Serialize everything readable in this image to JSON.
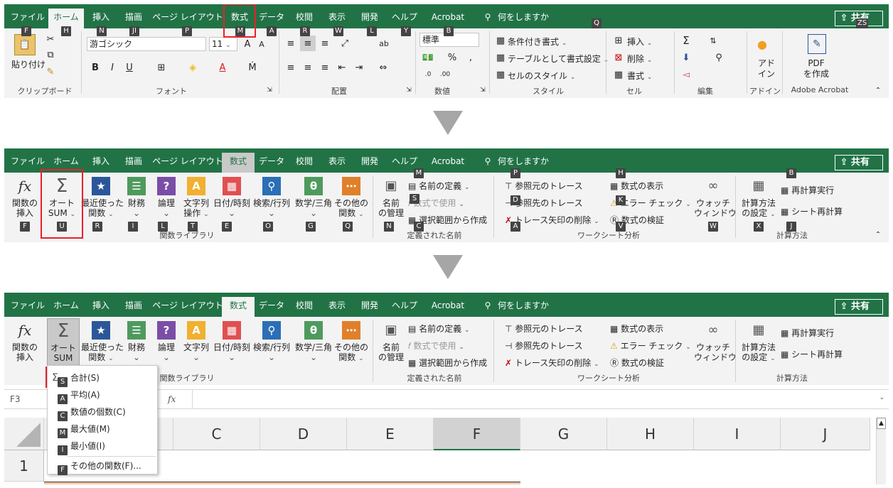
{
  "tabs": [
    "ファイル",
    "ホーム",
    "挿入",
    "描画",
    "ページ レイアウト",
    "数式",
    "データ",
    "校閲",
    "表示",
    "開発",
    "ヘルプ",
    "Acrobat",
    "何をしますか"
  ],
  "share_label": "共有",
  "lightbulb_icon": "lightbulb-icon",
  "p1": {
    "keytips": {
      "file": "F",
      "home": "H",
      "insert": "N",
      "draw": "JI",
      "layout": "P",
      "formula": "M",
      "data": "A",
      "review": "R",
      "view": "W",
      "dev": "L",
      "help": "Y",
      "acrobat": "B",
      "tell": "Q",
      "share": "ZS"
    },
    "paste": "貼り付け",
    "font_name": "游ゴシック",
    "font_size": "11",
    "number_format": "標準",
    "cond_format": "条件付き書式",
    "table_format": "テーブルとして書式設定",
    "cell_style": "セルのスタイル",
    "insert": "挿入",
    "delete": "削除",
    "format": "書式",
    "addin_l1": "アド",
    "addin_l2": "イン",
    "pdf_l1": "PDF",
    "pdf_l2": "を作成",
    "groups": {
      "clipboard": "クリップボード",
      "font": "フォント",
      "align": "配置",
      "number": "数値",
      "style": "スタイル",
      "cells": "セル",
      "edit": "編集",
      "addin": "アドイン",
      "acrobat": "Adobe Acrobat"
    }
  },
  "p2": {
    "keytips": {
      "insert_fn": "F",
      "autosum": "U",
      "recent": "R",
      "finance": "I",
      "logic": "L",
      "text": "T",
      "date": "E",
      "lookup": "O",
      "math": "G",
      "other": "Q",
      "name_mgr": "N",
      "define": "M",
      "use": "S",
      "create": "C",
      "trace_pre": "P",
      "trace_dep": "D",
      "remove": "A",
      "show": "H",
      "error": "K",
      "eval": "V",
      "watch": "W",
      "calc_opt": "X",
      "calc_now": "B",
      "calc_sheet": "J"
    },
    "buttons": {
      "insert_fn": [
        "関数の",
        "挿入"
      ],
      "autosum": [
        "オート",
        "SUM"
      ],
      "recent": [
        "最近使った",
        "関数"
      ],
      "finance": [
        "財務",
        ""
      ],
      "logic": [
        "論理",
        ""
      ],
      "text": [
        "文字列",
        "操作"
      ],
      "date": [
        "日付/時刻",
        ""
      ],
      "lookup": [
        "検索/行列",
        ""
      ],
      "math": [
        "数学/三角",
        ""
      ],
      "other": [
        "その他の",
        "関数"
      ],
      "name_mgr": [
        "名前",
        "の管理"
      ],
      "watch": [
        "ウォッチ",
        "ウィンドウ"
      ],
      "calc_opt": [
        "計算方法",
        "の設定"
      ]
    },
    "define_name": "名前の定義",
    "use_in_formula": "数式で使用",
    "create_from": "選択範囲から作成",
    "trace_precedents": "参照元のトレース",
    "trace_dependents": "参照先のトレース",
    "remove_arrows": "トレース矢印の削除",
    "show_formulas": "数式の表示",
    "error_check": "エラー チェック",
    "evaluate": "数式の検証",
    "calc_now": "再計算実行",
    "calc_sheet": "シート再計算",
    "groups": {
      "library": "関数ライブラリ",
      "names": "定義された名前",
      "audit": "ワークシート分析",
      "calc": "計算方法"
    }
  },
  "p3": {
    "namebox": "F3",
    "fx": "fx",
    "columns": [
      "C",
      "D",
      "E",
      "F",
      "G",
      "H",
      "I",
      "J"
    ],
    "row1": "1",
    "menu": [
      {
        "key": "S",
        "label": "合計(S)"
      },
      {
        "key": "A",
        "label": "平均(A)"
      },
      {
        "key": "C",
        "label": "数値の個数(C)"
      },
      {
        "key": "M",
        "label": "最大値(M)"
      },
      {
        "key": "I",
        "label": "最小値(I)"
      },
      {
        "key": "F",
        "label": "その他の関数(F)..."
      }
    ]
  },
  "colors": {
    "excel_green": "#217346",
    "highlight_red": "#e8202a",
    "cell_fill": "#f9c8a8"
  }
}
